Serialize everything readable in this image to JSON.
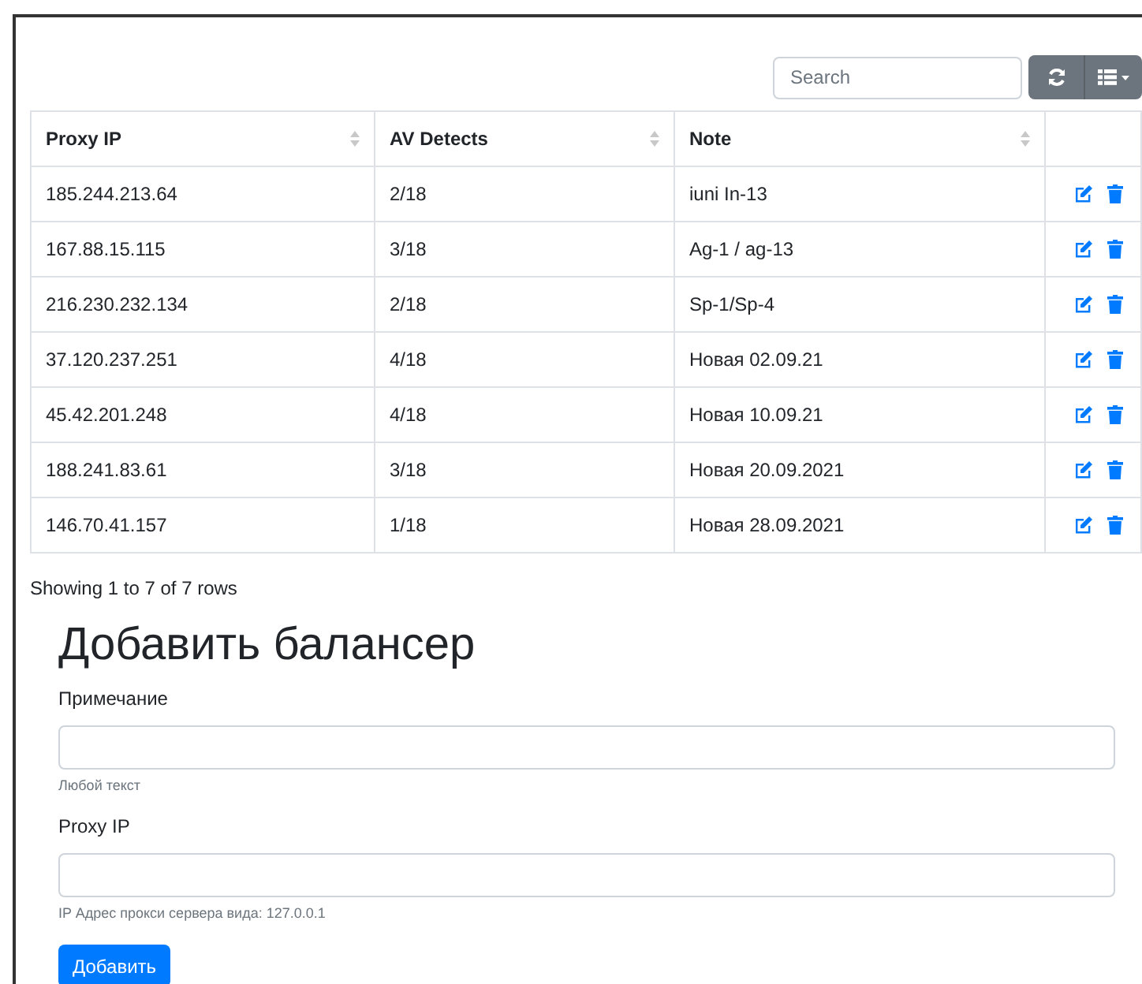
{
  "toolbar": {
    "search": {
      "placeholder": "Search"
    }
  },
  "table": {
    "columns": [
      "Proxy IP",
      "AV Detects",
      "Note"
    ],
    "rows": [
      [
        "185.244.213.64",
        "2/18",
        "iuni In-13"
      ],
      [
        "167.88.15.115",
        "3/18",
        "Ag-1 / ag-13"
      ],
      [
        "216.230.232.134",
        "2/18",
        "Sp-1/Sp-4"
      ],
      [
        "37.120.237.251",
        "4/18",
        "Новая 02.09.21"
      ],
      [
        "45.42.201.248",
        "4/18",
        "Новая 10.09.21"
      ],
      [
        "188.241.83.61",
        "3/18",
        "Новая 20.09.2021"
      ],
      [
        "146.70.41.157",
        "1/18",
        "Новая 28.09.2021"
      ]
    ]
  },
  "pagination": "Showing 1 to 7 of 7 rows",
  "form": {
    "title": "Добавить балансер",
    "fields": [
      {
        "label": "Примечание",
        "help": "Любой текст"
      },
      {
        "label": "Proxy IP",
        "help": "IP Адрес прокси сервера вида: 127.0.0.1"
      }
    ],
    "submit": "Добавить"
  }
}
